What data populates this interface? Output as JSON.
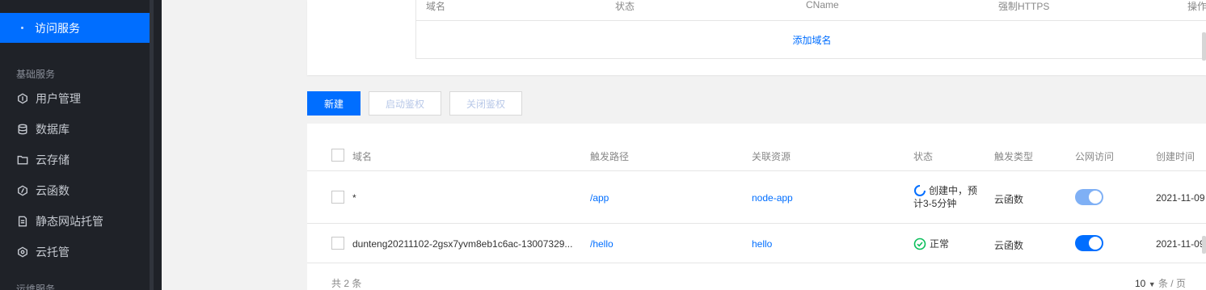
{
  "sidebar": {
    "active_item": "访问服务",
    "section_basic": "基础服务",
    "items": [
      {
        "label": "用户管理",
        "icon": "user-manage-icon"
      },
      {
        "label": "数据库",
        "icon": "database-icon"
      },
      {
        "label": "云存储",
        "icon": "folder-icon"
      },
      {
        "label": "云函数",
        "icon": "function-icon"
      },
      {
        "label": "静态网站托管",
        "icon": "document-icon"
      },
      {
        "label": "云托管",
        "icon": "hexagon-icon"
      }
    ],
    "section_ops": "运维服务"
  },
  "domain_table": {
    "headers": [
      "域名",
      "状态",
      "CName",
      "强制HTTPS",
      "操作"
    ],
    "add_domain": "添加域名"
  },
  "toolbar": {
    "new_label": "新建",
    "enable_auth_label": "启动鉴权",
    "disable_auth_label": "关闭鉴权"
  },
  "routes_table": {
    "headers": [
      "域名",
      "触发路径",
      "关联资源",
      "状态",
      "触发类型",
      "公网访问",
      "创建时间"
    ],
    "rows": [
      {
        "domain": "*",
        "path": "/app",
        "resource": "node-app",
        "status": "创建中，预计3-5分钟",
        "status_line1": "创建中，预",
        "status_line2": "计3-5分钟",
        "trigger": "云函数",
        "public": true,
        "public_state": "disabled",
        "created": "2021-11-09"
      },
      {
        "domain": "dunteng20211102-2gsx7yvm8eb1c6ac-13007329...",
        "path": "/hello",
        "resource": "hello",
        "status": "正常",
        "trigger": "云函数",
        "public": true,
        "public_state": "on",
        "created": "2021-11-09"
      }
    ],
    "total": "共 2 条",
    "page_size": "10",
    "per_page_unit": "条 / 页"
  },
  "colors": {
    "accent": "#006eff",
    "sidebar_bg": "#1f2228",
    "success": "#0abf5b",
    "toggle_disabled": "#7fb0f5"
  }
}
